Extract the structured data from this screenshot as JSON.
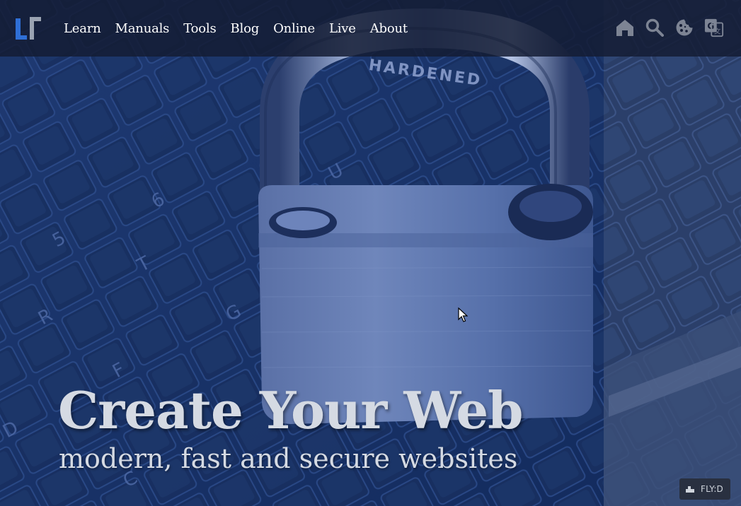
{
  "nav": {
    "items": [
      {
        "label": "Learn"
      },
      {
        "label": "Manuals"
      },
      {
        "label": "Tools"
      },
      {
        "label": "Blog"
      },
      {
        "label": "Online"
      },
      {
        "label": "Live"
      },
      {
        "label": "About"
      }
    ]
  },
  "toolbar": {
    "icons": [
      "home-icon",
      "search-icon",
      "cookie-icon",
      "translate-icon"
    ]
  },
  "hero": {
    "title": "Create Your Web",
    "subtitle": "modern, fast and secure websites",
    "image_subject": "padlock on laptop keyboard",
    "engraving": "HARDENED"
  },
  "badge": {
    "label": "FLY:D"
  },
  "colors": {
    "overlay_blue": "#1b3b7a",
    "topbar": "#141c34",
    "hero_text": "#d5dae3",
    "logo_blue": "#2f6fd6",
    "logo_gray": "#9aa3b2"
  }
}
